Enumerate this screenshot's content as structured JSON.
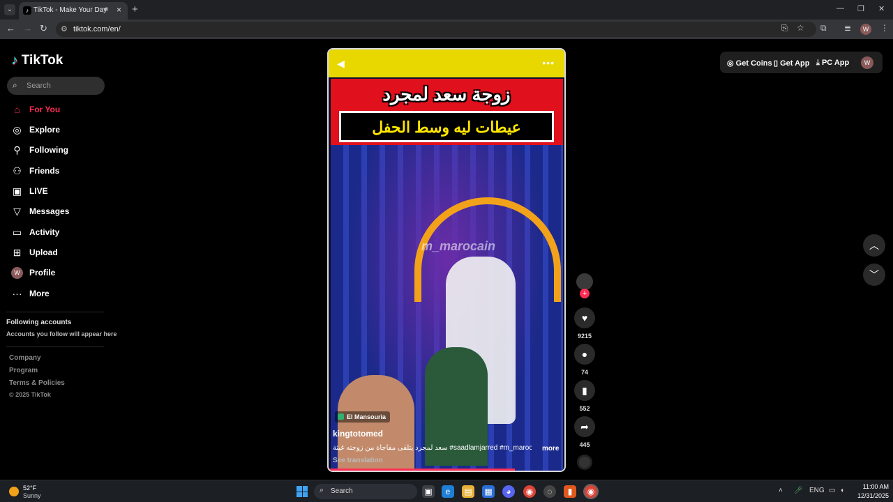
{
  "browser": {
    "tab_title": "TikTok - Make Your Day",
    "url": "tiktok.com/en/",
    "profile_initial": "W"
  },
  "sidebar": {
    "logo": "TikTok",
    "search_placeholder": "Search",
    "items": [
      {
        "label": "For You",
        "icon": "home-icon",
        "active": true
      },
      {
        "label": "Explore",
        "icon": "compass-icon"
      },
      {
        "label": "Following",
        "icon": "following-icon"
      },
      {
        "label": "Friends",
        "icon": "friends-icon"
      },
      {
        "label": "LIVE",
        "icon": "live-icon"
      },
      {
        "label": "Messages",
        "icon": "messages-icon"
      },
      {
        "label": "Activity",
        "icon": "activity-icon"
      },
      {
        "label": "Upload",
        "icon": "upload-icon"
      },
      {
        "label": "Profile",
        "icon": "avatar"
      },
      {
        "label": "More",
        "icon": "more-icon"
      }
    ],
    "profile_initial": "W",
    "following_title": "Following accounts",
    "following_sub": "Accounts you follow will appear here",
    "footer_links": [
      "Company",
      "Program",
      "Terms & Policies"
    ],
    "copyright": "© 2025 TikTok"
  },
  "header": {
    "get_coins": "Get Coins",
    "get_app": "Get App",
    "pc_app": "PC App",
    "avatar_initial": "W"
  },
  "video": {
    "overlay_title": "زوجة سعد لمجرد",
    "overlay_subtitle": "عيطات ليه وسط الحفل",
    "watermark": "m_marocain",
    "place_tag": "El Mansouria",
    "author": "kingtotomed",
    "caption": "سعد لمجرد يتلقى مفاجأة من زوجته غيثة #saadlamjarred #m_marocain",
    "more": "more",
    "see_translation": "See translation",
    "progress": 0.79
  },
  "actions": {
    "likes": "9215",
    "comments": "74",
    "saves": "552",
    "shares": "445"
  },
  "taskbar": {
    "temperature": "52°F",
    "condition": "Sunny",
    "search_placeholder": "Search",
    "language": "ENG",
    "time": "11:00 AM",
    "date": "12/31/2025"
  },
  "colors": {
    "accent": "#fe2c55",
    "background": "#000000",
    "video_band": "#e0101c",
    "video_subtitle": "#ffe600"
  }
}
